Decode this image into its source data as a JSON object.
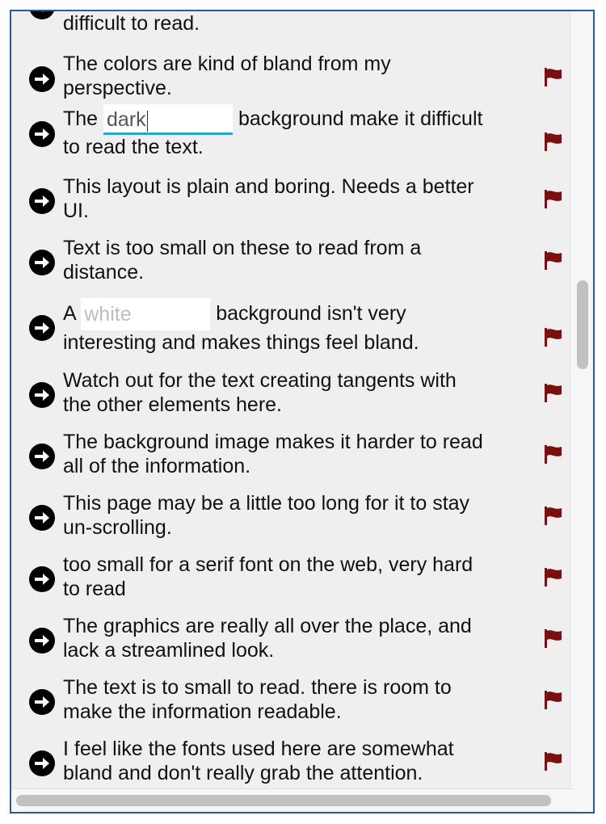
{
  "items": [
    {
      "lines": [
        "difficult to read."
      ]
    },
    {
      "lines": [
        "The colors are kind of bland from my",
        "perspective."
      ]
    },
    {
      "pre": "The ",
      "input": {
        "value": "dark",
        "placeholder": "dark"
      },
      "post": " background make it difficult",
      "line2": "to read the text."
    },
    {
      "lines": [
        "This layout is plain and boring. Needs a better",
        "UI."
      ]
    },
    {
      "lines": [
        "Text is too small on these to read from a",
        "distance."
      ]
    },
    {
      "pre": "A ",
      "input": {
        "value": "",
        "placeholder": "white"
      },
      "post": " background isn't very",
      "line2": "interesting and makes things feel bland."
    },
    {
      "lines": [
        "Watch out for the text creating tangents with",
        "the other elements here."
      ]
    },
    {
      "lines": [
        "The background image makes it harder to read",
        "all of the information."
      ]
    },
    {
      "lines": [
        "This page may be a little too long for it to stay",
        "un-scrolling."
      ]
    },
    {
      "lines": [
        "too small for a serif font on the web, very hard",
        "to read"
      ]
    },
    {
      "lines": [
        "The graphics are really all over the place, and",
        "lack a streamlined look."
      ]
    },
    {
      "lines": [
        "The text is to small to read. there is room to",
        "make the information readable."
      ]
    },
    {
      "lines": [
        "I feel like the fonts used here are somewhat",
        "bland and don't really grab the attention."
      ]
    }
  ],
  "icons": {
    "go": "arrow-right-circle-icon",
    "report": "flag-icon"
  },
  "colors": {
    "border": "#2a5c9c",
    "flag": "#7a0f0f",
    "input_underline": "#2aa6c4"
  }
}
